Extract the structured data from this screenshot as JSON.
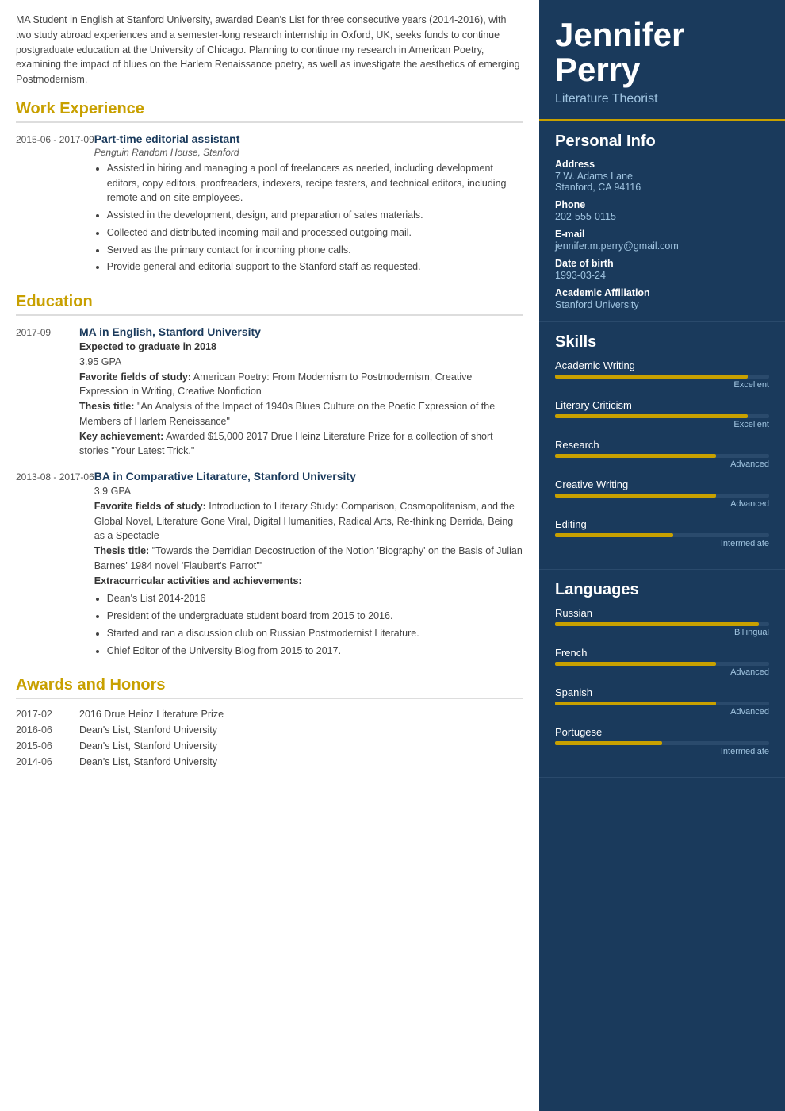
{
  "summary": "MA Student in English at Stanford University, awarded Dean's List for three consecutive years (2014-2016), with two study abroad experiences and a semester-long research internship in Oxford, UK, seeks funds to continue postgraduate education at the University of Chicago. Planning to continue my research in American Poetry, examining the impact of blues on the Harlem Renaissance poetry, as well as investigate the aesthetics of emerging Postmodernism.",
  "sections": {
    "work_experience_title": "Work Experience",
    "education_title": "Education",
    "awards_title": "Awards and Honors"
  },
  "work": [
    {
      "date": "2015-06 - 2017-09",
      "title": "Part-time editorial assistant",
      "subtitle": "Penguin Random House, Stanford",
      "bullets": [
        "Assisted in hiring and managing a pool of freelancers as needed, including development editors, copy editors, proofreaders, indexers, recipe testers, and technical editors, including remote and on-site employees.",
        "Assisted in the development, design, and preparation of sales materials.",
        "Collected and distributed incoming mail and processed outgoing mail.",
        "Served as the primary contact for incoming phone calls.",
        "Provide general and editorial support to the Stanford staff as requested."
      ]
    }
  ],
  "education": [
    {
      "date": "2017-09",
      "title": "MA in English, Stanford University",
      "gpa_label": "Expected to graduate in 2018",
      "gpa": "3.95 GPA",
      "favorite_fields_label": "Favorite fields of study:",
      "favorite_fields": "American Poetry: From Modernism to Postmodernism, Creative Expression in Writing, Creative Nonfiction",
      "thesis_label": "Thesis title:",
      "thesis": "\"An Analysis of the Impact of 1940s Blues Culture on the Poetic Expression of the Members of Harlem Reneissance\"",
      "achievement_label": "Key achievement:",
      "achievement": "Awarded $15,000 2017 Drue Heinz Literature Prize for a collection of short stories \"Your Latest Trick.\""
    },
    {
      "date": "2013-08 - 2017-06",
      "title": "BA in Comparative Litarature, Stanford University",
      "gpa": "3.9 GPA",
      "favorite_fields_label": "Favorite fields of study:",
      "favorite_fields": "Introduction to Literary Study: Comparison, Cosmopolitanism, and the Global Novel, Literature Gone Viral, Digital Humanities, Radical Arts, Re-thinking Derrida, Being as a Spectacle",
      "thesis_label": "Thesis title:",
      "thesis": "\"Towards the Derridian Decostruction of the Notion 'Biography' on the Basis of Julian Barnes' 1984 novel 'Flaubert's Parrot'\"",
      "extra_label": "Extracurricular activities and achievements:",
      "extra_bullets": [
        "Dean's List 2014-2016",
        "President of the undergraduate student board from 2015 to 2016.",
        "Started and ran a discussion club on Russian Postmodernist Literature.",
        "Chief Editor of the University Blog from 2015 to 2017."
      ]
    }
  ],
  "awards": [
    {
      "date": "2017-02",
      "title": "2016 Drue Heinz Literature Prize"
    },
    {
      "date": "2016-06",
      "title": "Dean's List, Stanford University"
    },
    {
      "date": "2015-06",
      "title": "Dean's List, Stanford University"
    },
    {
      "date": "2014-06",
      "title": "Dean's List, Stanford University"
    }
  ],
  "profile": {
    "first_name": "Jennifer",
    "last_name": "Perry",
    "job_title": "Literature Theorist",
    "personal_info_title": "Personal Info",
    "address_label": "Address",
    "address_line1": "7 W. Adams Lane",
    "address_line2": "Stanford, CA 94116",
    "phone_label": "Phone",
    "phone": "202-555-0115",
    "email_label": "E-mail",
    "email": "jennifer.m.perry@gmail.com",
    "dob_label": "Date of birth",
    "dob": "1993-03-24",
    "affiliation_label": "Academic Affiliation",
    "affiliation": "Stanford University",
    "skills_title": "Skills",
    "skills": [
      {
        "name": "Academic Writing",
        "level": "Excellent",
        "pct": 90
      },
      {
        "name": "Literary Criticism",
        "level": "Excellent",
        "pct": 90
      },
      {
        "name": "Research",
        "level": "Advanced",
        "pct": 75
      },
      {
        "name": "Creative Writing",
        "level": "Advanced",
        "pct": 75
      },
      {
        "name": "Editing",
        "level": "Intermediate",
        "pct": 55
      }
    ],
    "languages_title": "Languages",
    "languages": [
      {
        "name": "Russian",
        "level": "Billingual",
        "pct": 95
      },
      {
        "name": "French",
        "level": "Advanced",
        "pct": 75
      },
      {
        "name": "Spanish",
        "level": "Advanced",
        "pct": 75
      },
      {
        "name": "Portugese",
        "level": "Intermediate",
        "pct": 50
      }
    ]
  }
}
